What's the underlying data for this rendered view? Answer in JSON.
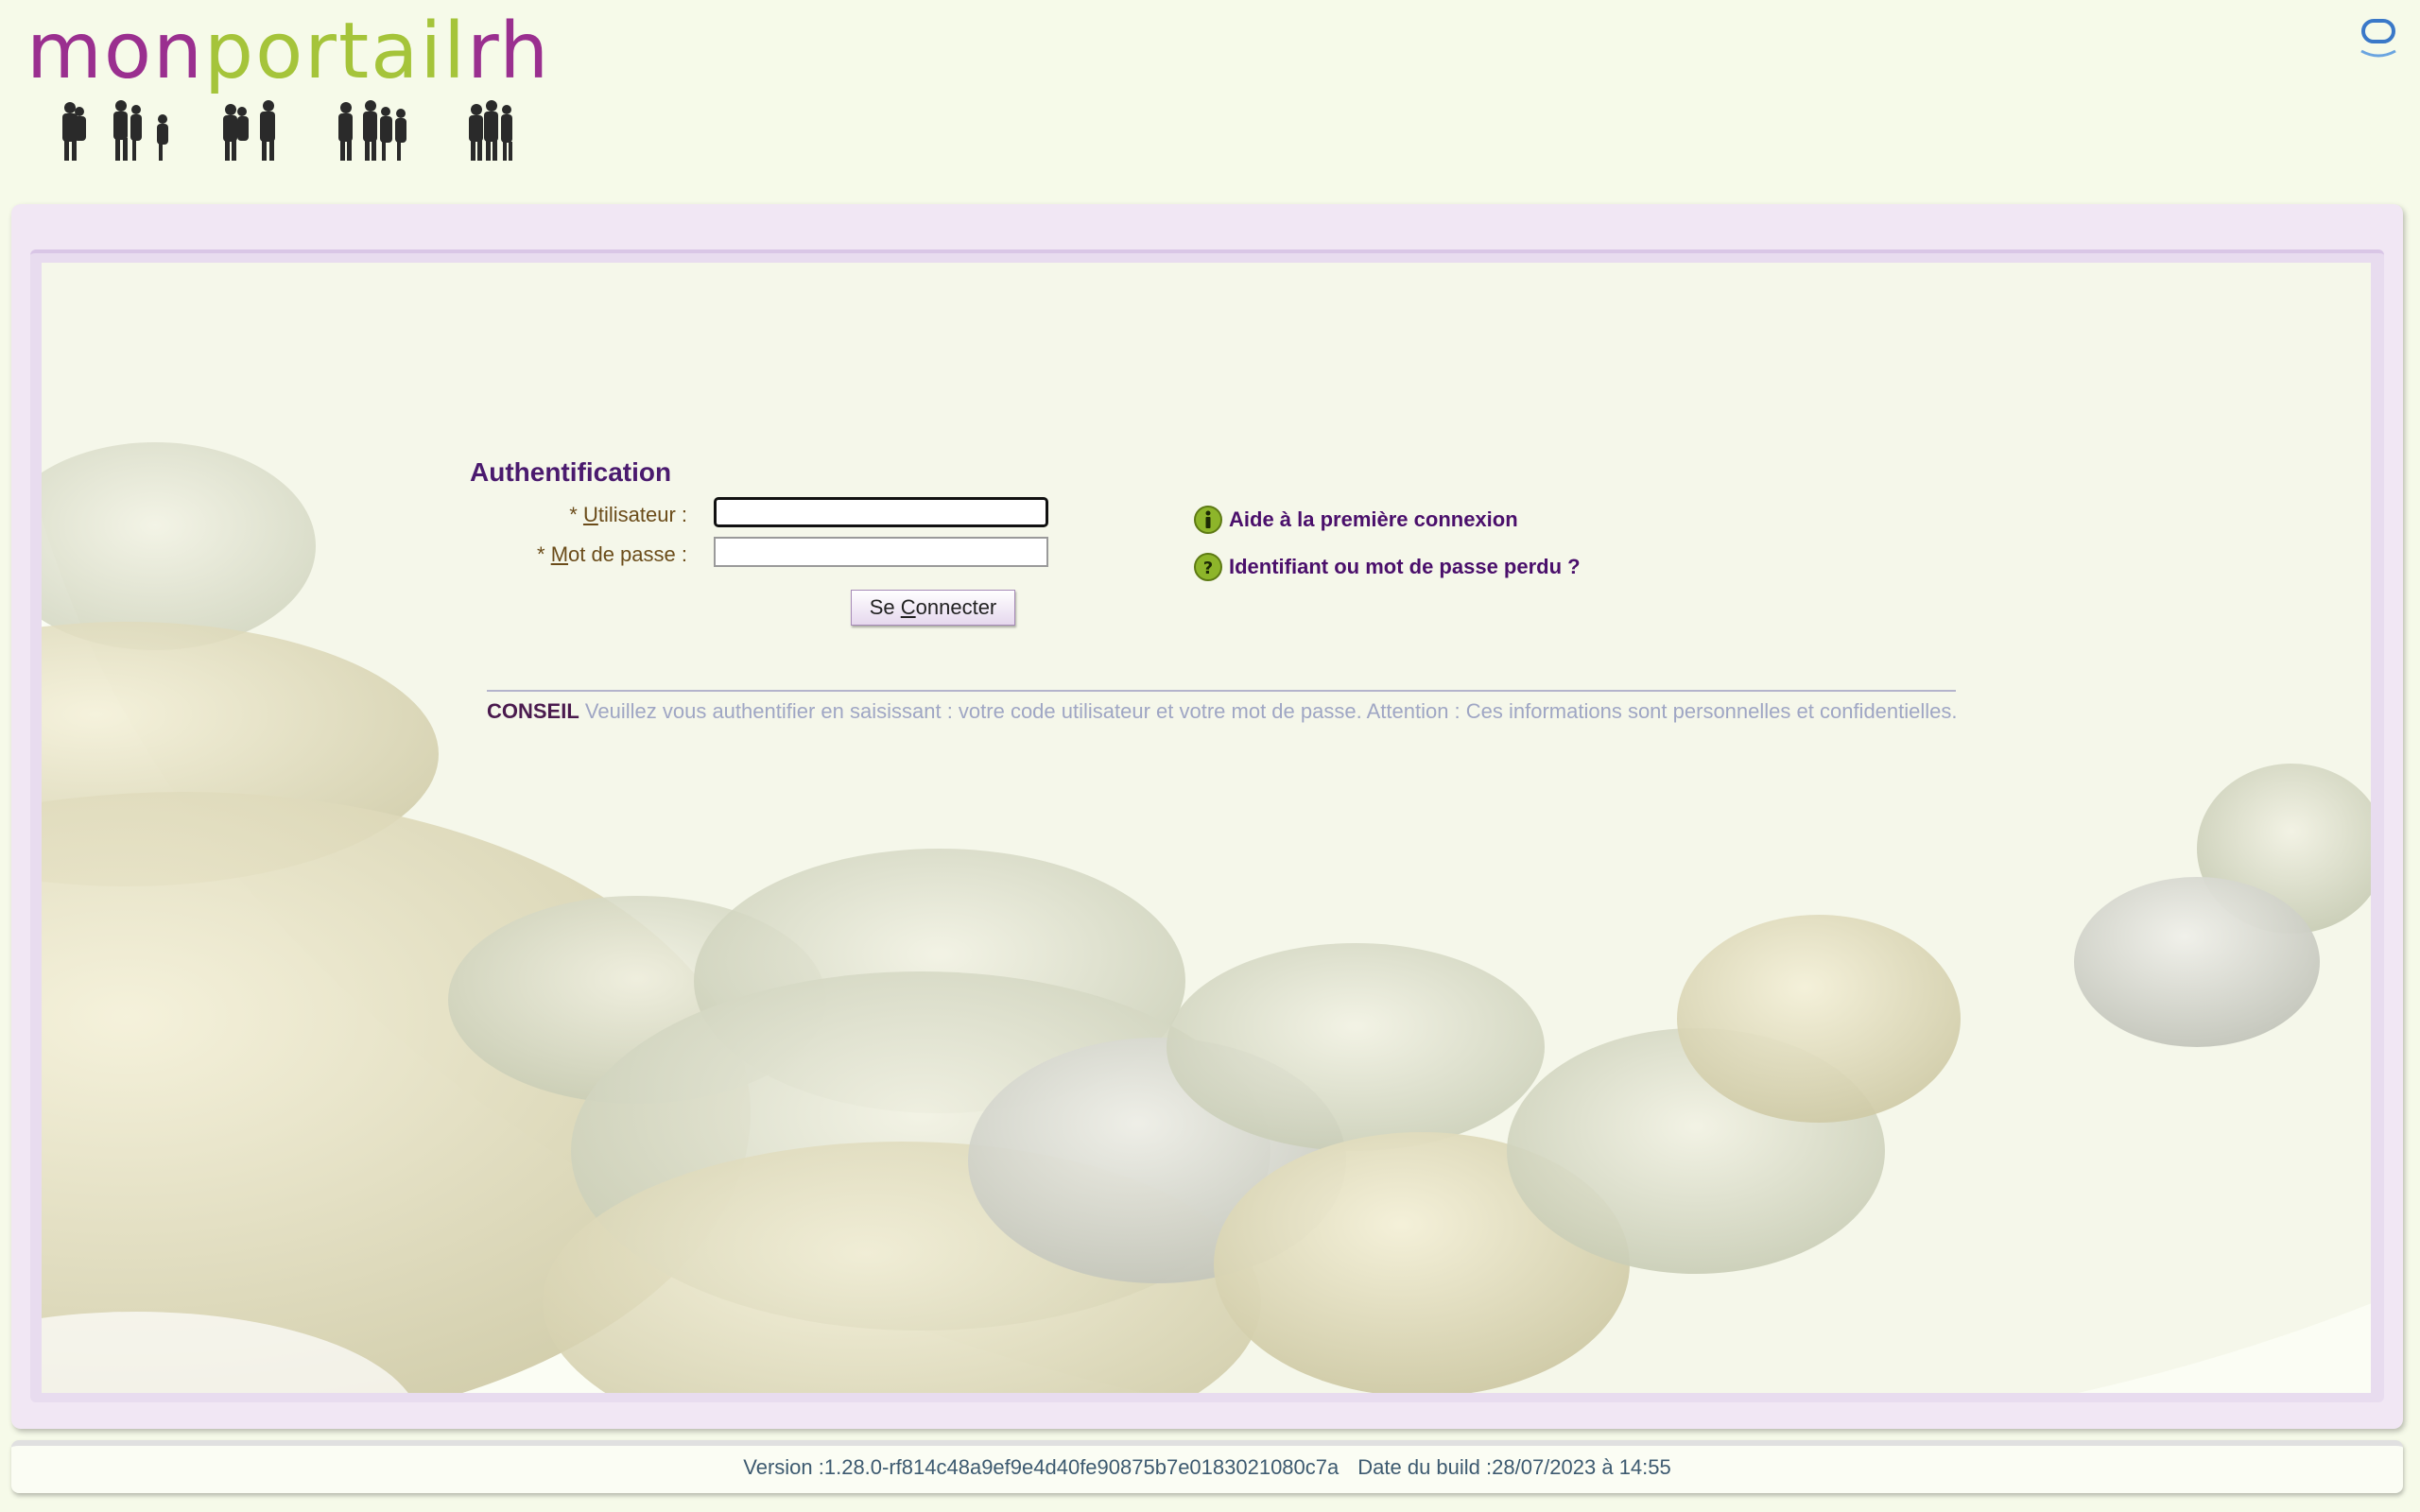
{
  "header": {
    "logo_part1": "mon",
    "logo_part2": "portail",
    "logo_part3": "rh",
    "top_icon": "user-session-icon"
  },
  "auth": {
    "title": "Authentification",
    "username_label_prefix": "* ",
    "username_label_accesskey": "U",
    "username_label_rest": "tilisateur :",
    "username_value": "",
    "password_label_prefix": "* ",
    "password_label_accesskey": "M",
    "password_label_rest": "ot de passe :",
    "password_value": "",
    "login_button_prefix": "Se ",
    "login_button_accesskey": "C",
    "login_button_rest": "onnecter"
  },
  "help": {
    "first_login_icon": "info-icon",
    "first_login_label": "Aide à la première connexion",
    "lost_password_icon": "question-icon",
    "lost_password_label": "Identifiant ou mot de passe perdu ?"
  },
  "conseil": {
    "label": "CONSEIL",
    "text": "Veuillez vous authentifier en saisissant : votre code utilisateur et votre mot de passe. Attention : Ces informations sont personnelles et confidentielles."
  },
  "footer": {
    "version": "Version :1.28.0-rf814c48a9ef9e4d40fe90875b7e0183021080c7a",
    "build_date": "Date du build :28/07/2023 à 14:55"
  },
  "colors": {
    "brand_purple": "#9a2f8f",
    "brand_green": "#a5c43a",
    "title_purple": "#4a1a6e"
  }
}
